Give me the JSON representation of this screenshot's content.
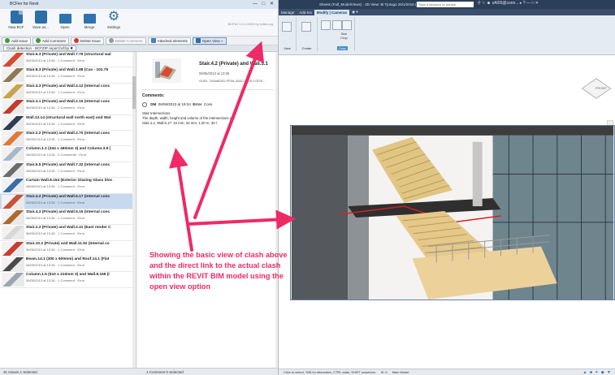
{
  "bcf": {
    "window_title": "BCFier for Revit",
    "version_text": "BCFier 1.0.1.0000 by bcfier.org",
    "ribbon": [
      {
        "label": "New BCF",
        "icon": "new-document-icon"
      },
      {
        "label": "Save as...",
        "icon": "save-icon"
      },
      {
        "label": "Open",
        "icon": "open-folder-icon"
      },
      {
        "label": "Merge",
        "icon": "merge-icon"
      },
      {
        "label": "Settings",
        "icon": "gear-icon"
      }
    ],
    "toolbar": {
      "add_issue": "Add Issue",
      "add_comment": "Add Comment",
      "delete_issue": "Delete Issue",
      "delete_comment": "Delete Comment",
      "attached_elements": "Attached elements",
      "open_view": "Open View »"
    },
    "tab_label": "Clash detection - BCFZIP report.bcfzip ✖",
    "issues": [
      {
        "title": "Stair.6.3 (Private) and Wall.7.76 (structural wal",
        "meta": "06/05/2013 at 13:36  ·  1 Comment  ·  Error"
      },
      {
        "title": "Stair.8.3 (Private) and Wall.1.88 (Cav - 102.75",
        "meta": "06/05/2013 at 13:36  ·  1 Comment  ·  Error"
      },
      {
        "title": "Stair.4.3 (Private) and Wall.4.12 (Internal conc",
        "meta": "06/05/2013 at 13:36  ·  1 Comment  ·  Error"
      },
      {
        "title": "Stair.3.1 (Private) and Wall.2.15 (Internal conc",
        "meta": "06/05/2013 at 13:36  ·  2 Comment  ·  Error"
      },
      {
        "title": "Wall.12.14 (structural wall north east) and Wal",
        "meta": "06/05/2013 at 13:36  ·  1 Comment  ·  Error"
      },
      {
        "title": "Stair.2.2 (Private) and Wall.2.70 (Internal conc",
        "meta": "06/05/2013 at 13:36  ·  1 Comment  ·  Error"
      },
      {
        "title": "Column.1.1 (344 x 460mm 3) and Column.3.9 (",
        "meta": "06/05/2013 at 13:36  ·  2 Comments  ·  Error"
      },
      {
        "title": "Stair.6.5 (Private) and Wall.7.32 (Internal conc",
        "meta": "06/05/2013 at 13:36  ·  1 Comment  ·  Error"
      },
      {
        "title": "Curtain Wall.8.154 (Exterior Glazing Glass bloc",
        "meta": "06/05/2013 at 13:36  ·  1 Comment  ·  Error"
      },
      {
        "title": "Stair.4.2 (Private) and Wall.5.17 (Internal conc",
        "meta": "06/05/2013 at 13:36  ·  1 Comment  ·  Error"
      },
      {
        "title": "Stair.4.3 (Private) and Wall.5.15 (Internal conc",
        "meta": "06/05/2013 at 13:36  ·  1 Comment  ·  Error"
      },
      {
        "title": "Stair.2.2 (Private) and Wall.2.41 (East render C",
        "meta": "06/05/2013 at 13:36  ·  1 Comment  ·  Error"
      },
      {
        "title": "Stair.10.2 (Private) and Wall.11.52 (Internal co",
        "meta": "06/05/2013 at 13:36  ·  1 Comment  ·  Error"
      },
      {
        "title": "Beam.14.1 (300 x 600mm) and Roof.14.1 (Flat",
        "meta": "06/05/2013 at 13:36  ·  1 Comment  ·  Error"
      },
      {
        "title": "Column.1.5 (510 x 410mm 3) and Wall.8.155 (l",
        "meta": "06/05/2013 at 13:36  ·  1 Comment  ·  Error"
      }
    ],
    "status_left": "31 Issues  1 Selected",
    "status_mid": "1 Comment  0 Selected",
    "detail": {
      "title": "Stair.4.2 (Private) and Wall.5.1",
      "date": "06/05/2013 at 13:36",
      "guid": "GUID: 7A3A8D0D-FF5A-42AC-8778-17E29...",
      "comments_heading": "Comments:",
      "comment_author": "DM",
      "comment_date": "06/06/2013 at 19:34",
      "comment_status": "Error",
      "comment_extra": "Cons",
      "comment_body": "Stair Intersections\nThe depth, width, height and volume of the intersections are:\nStair.4.2, Wall.5.17: 34 mm, 34 mm, 1,20 m, 30 l"
    }
  },
  "revit": {
    "title": "Sheets (Full_ModelViews) - 3D View: Bi Tjotogo 25/1/2016 (3D)",
    "search_placeholder": "Type a keyword or phrase",
    "user": "sAI05@conn...",
    "tabs": [
      "Manage",
      "Add-Ins",
      "Modify | Cameras",
      "◉ ▾"
    ],
    "groups": {
      "view": "View",
      "create": "Create",
      "crop": "Crop"
    },
    "size_crop": "Size\nCrop",
    "viewcube": "FRONT",
    "status_items": [
      "Click to select, TAB for alternates, CTRL adds, SHIFT unselects.",
      "⊕ :0",
      "Main Model"
    ],
    "status_icons": "▲ ■ ✦ ◆ ▼"
  },
  "annotation": {
    "text": "Showing the basic view of clash above and the direct link to the actual clash within the REVIT BIM model using the open view option",
    "color": "#ee2a67"
  }
}
